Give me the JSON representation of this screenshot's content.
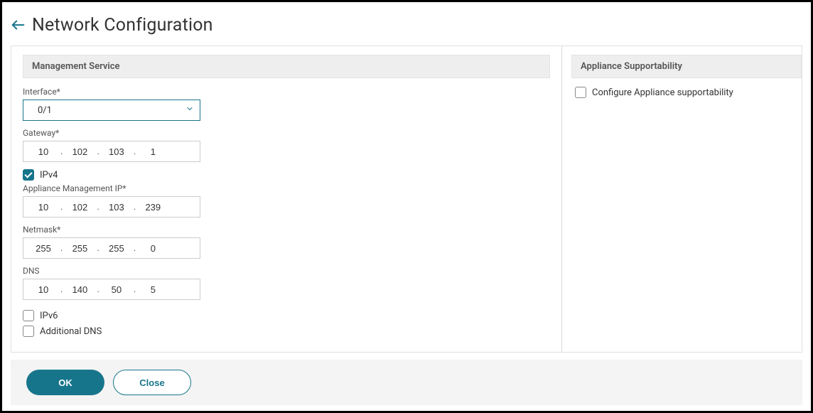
{
  "header": {
    "title": "Network Configuration"
  },
  "sections": {
    "management": {
      "title": "Management Service",
      "interface": {
        "label": "Interface*",
        "value": "0/1"
      },
      "gateway": {
        "label": "Gateway*",
        "octets": [
          "10",
          "102",
          "103",
          "1"
        ]
      },
      "ipv4": {
        "label": "IPv4",
        "checked": true
      },
      "appliance_ip": {
        "label": "Appliance Management IP*",
        "octets": [
          "10",
          "102",
          "103",
          "239"
        ]
      },
      "netmask": {
        "label": "Netmask*",
        "octets": [
          "255",
          "255",
          "255",
          "0"
        ]
      },
      "dns": {
        "label": "DNS",
        "octets": [
          "10",
          "140",
          "50",
          "5"
        ]
      },
      "ipv6": {
        "label": "IPv6",
        "checked": false
      },
      "additional_dns": {
        "label": "Additional DNS",
        "checked": false
      }
    },
    "supportability": {
      "title": "Appliance Supportability",
      "configure": {
        "label": "Configure Appliance supportability",
        "checked": false
      }
    }
  },
  "footer": {
    "ok": "OK",
    "close": "Close"
  }
}
